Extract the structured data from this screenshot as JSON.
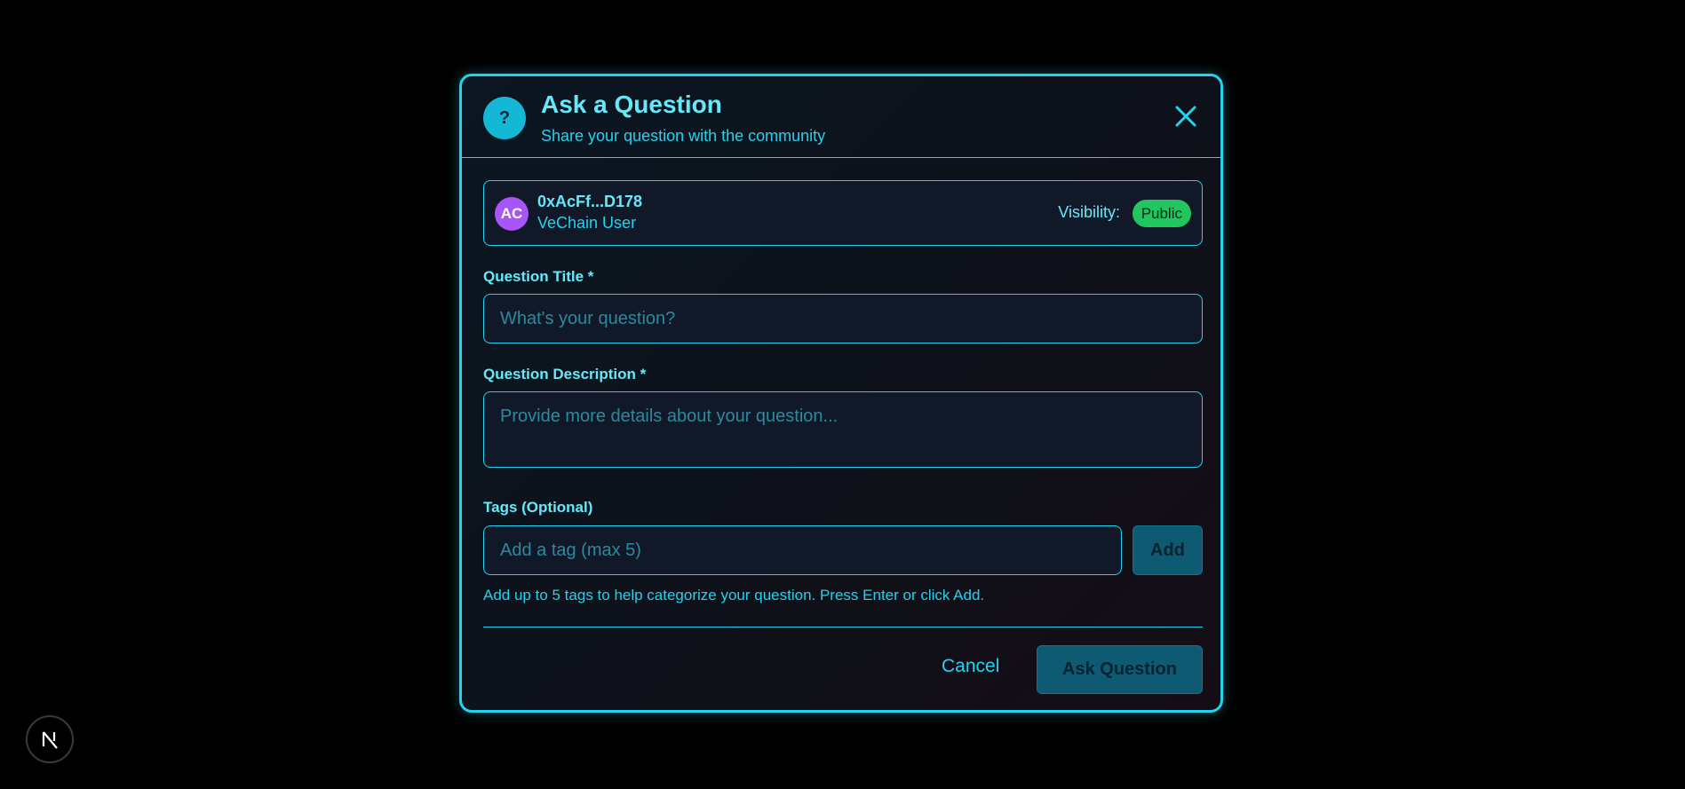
{
  "modal": {
    "icon": "question-mark-icon",
    "icon_glyph": "?",
    "title": "Ask a Question",
    "subtitle": "Share your question with the community",
    "close_icon": "close-icon"
  },
  "user": {
    "avatar_initials": "AC",
    "address": "0xAcFf...D178",
    "role": "VeChain User",
    "visibility_label": "Visibility:",
    "visibility_value": "Public"
  },
  "form": {
    "title_label": "Question Title *",
    "title_placeholder": "What's your question?",
    "title_value": "",
    "description_label": "Question Description *",
    "description_placeholder": "Provide more details about your question...",
    "description_value": "",
    "tags_label": "Tags (Optional)",
    "tags_placeholder": "Add a tag (max 5)",
    "tags_value": "",
    "add_button": "Add",
    "tags_helper": "Add up to 5 tags to help categorize your question. Press Enter or click Add."
  },
  "footer": {
    "cancel_label": "Cancel",
    "submit_label": "Ask Question"
  },
  "overlay": {
    "dev_badge_glyph": "N",
    "dev_badge_icon": "nextjs-logo-icon"
  },
  "colors": {
    "accent": "#22d3ee",
    "accent_light": "#67e8f9",
    "avatar_bg": "#a855f7",
    "public_badge_bg": "#22c55e",
    "button_bg": "#0e5a73",
    "background": "#000000"
  }
}
